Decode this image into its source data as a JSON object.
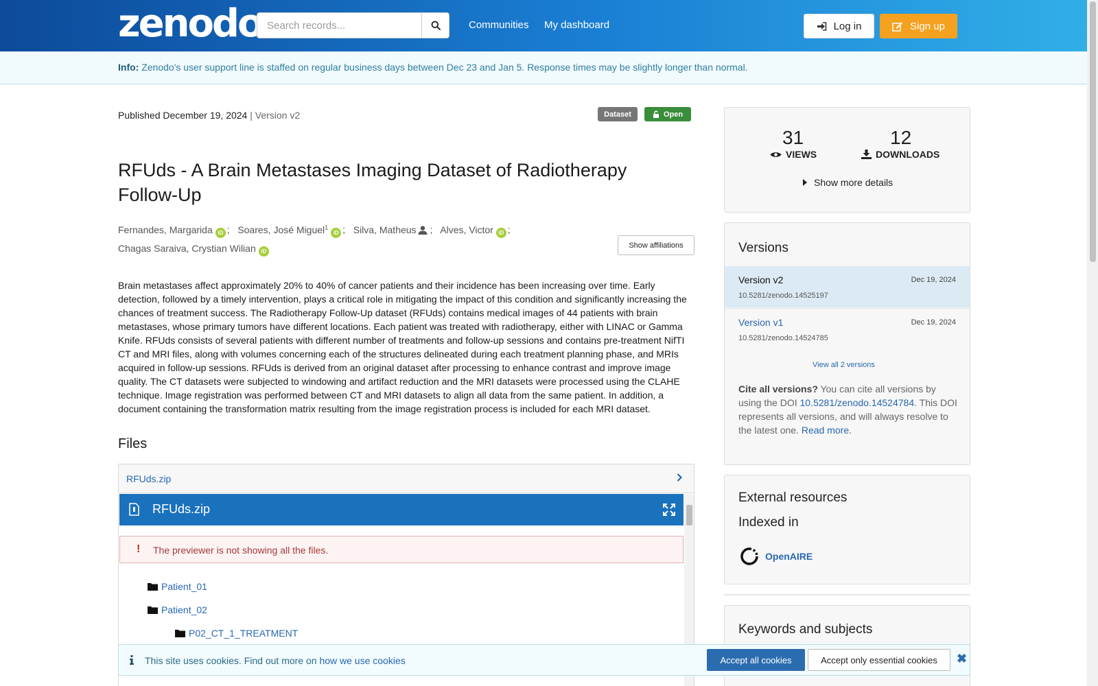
{
  "header": {
    "logo": "zenodo",
    "search_placeholder": "Search records...",
    "nav": [
      "Communities",
      "My dashboard"
    ],
    "login_label": "Log in",
    "signup_label": "Sign up"
  },
  "info_banner": {
    "label": "Info:",
    "text": "Zenodo's user support line is staffed on regular business days between Dec 23 and Jan 5. Response times may be slightly longer than normal."
  },
  "record": {
    "published": "Published December 19, 2024",
    "version": "| Version v2",
    "badge_type": "Dataset",
    "badge_access": "Open",
    "title": "RFUds - A Brain Metastases Imaging Dataset of Radiotherapy Follow-Up",
    "authors": [
      {
        "name": "Fernandes, Margarida",
        "orcid": true,
        "sup": "",
        "person": false
      },
      {
        "name": "Soares, José Miguel",
        "orcid": true,
        "sup": "1",
        "person": false
      },
      {
        "name": "Silva, Matheus",
        "orcid": false,
        "sup": "",
        "person": true
      },
      {
        "name": "Alves, Victor",
        "orcid": true,
        "sup": "",
        "person": false
      },
      {
        "name": "Chagas Saraiva, Crystian Wilian",
        "orcid": true,
        "sup": "",
        "person": false
      }
    ],
    "show_affiliations": "Show affiliations",
    "description": "Brain metastases affect approximately 20% to 40% of cancer patients and their incidence has been increasing over time. Early detection, followed by a timely intervention, plays a critical role in mitigating the impact of this condition and significantly increasing the chances of treatment success. The Radiotherapy Follow-Up dataset (RFUds) contains medical images of 44 patients with brain metastases, whose primary tumors have different locations. Each patient was treated with radiotherapy, either with LINAC or Gamma Knife. RFUds consists of several patients with different number of treatments and follow-up sessions and contains pre-treatment NifTI CT and MRI files, along with volumes concerning each of the structures delineated during each treatment planning phase, and MRIs acquired in follow-up sessions. RFUds is derived from an original dataset after processing to enhance contrast and improve image quality. The CT datasets were subjected to windowing and artifact reduction and the MRI datasets were processed using the CLAHE technique. Image registration was performed between CT and MRI datasets to align all data from the same patient. In addition, a document containing the transformation matrix resulting from the image registration process is included for each MRI dataset."
  },
  "files": {
    "heading": "Files",
    "file_link": "RFUds.zip",
    "preview_title": "RFUds.zip",
    "warning": "The previewer is not showing all the files.",
    "tree": [
      "Patient_01",
      "Patient_02",
      "P02_CT_1_TREATMENT"
    ]
  },
  "stats": {
    "views": "31",
    "views_label": "VIEWS",
    "downloads": "12",
    "downloads_label": "DOWNLOADS",
    "more": "Show more details"
  },
  "versions": {
    "heading": "Versions",
    "items": [
      {
        "name": "Version v2",
        "date": "Dec 19, 2024",
        "doi": "10.5281/zenodo.14525197"
      },
      {
        "name": "Version v1",
        "date": "Dec 19, 2024",
        "doi": "10.5281/zenodo.14524785"
      }
    ],
    "view_all": "View all 2 versions",
    "cite_bold": "Cite all versions?",
    "cite_text1": " You can cite all versions by using the DOI ",
    "cite_doi": "10.5281/zenodo.14524784",
    "cite_text2": ". This DOI represents all versions, and will always resolve to the latest one. ",
    "read_more": "Read more."
  },
  "external": {
    "heading": "External resources",
    "indexed": "Indexed in",
    "openaire": "OpenAIRE"
  },
  "keywords": {
    "heading": "Keywords and subjects"
  },
  "cookie": {
    "text": "This site uses cookies. Find out more on ",
    "link": "how we use cookies",
    "accept_all": "Accept all cookies",
    "accept_essential": "Accept only essential cookies"
  },
  "colors": {
    "header_start": "#0d4a9a",
    "header_end": "#31aee8",
    "signup": "#f4a11f",
    "link": "#2767b0",
    "open_badge": "#3a8d3a",
    "dataset_badge": "#767676",
    "preview_bar": "#1a72bd"
  }
}
